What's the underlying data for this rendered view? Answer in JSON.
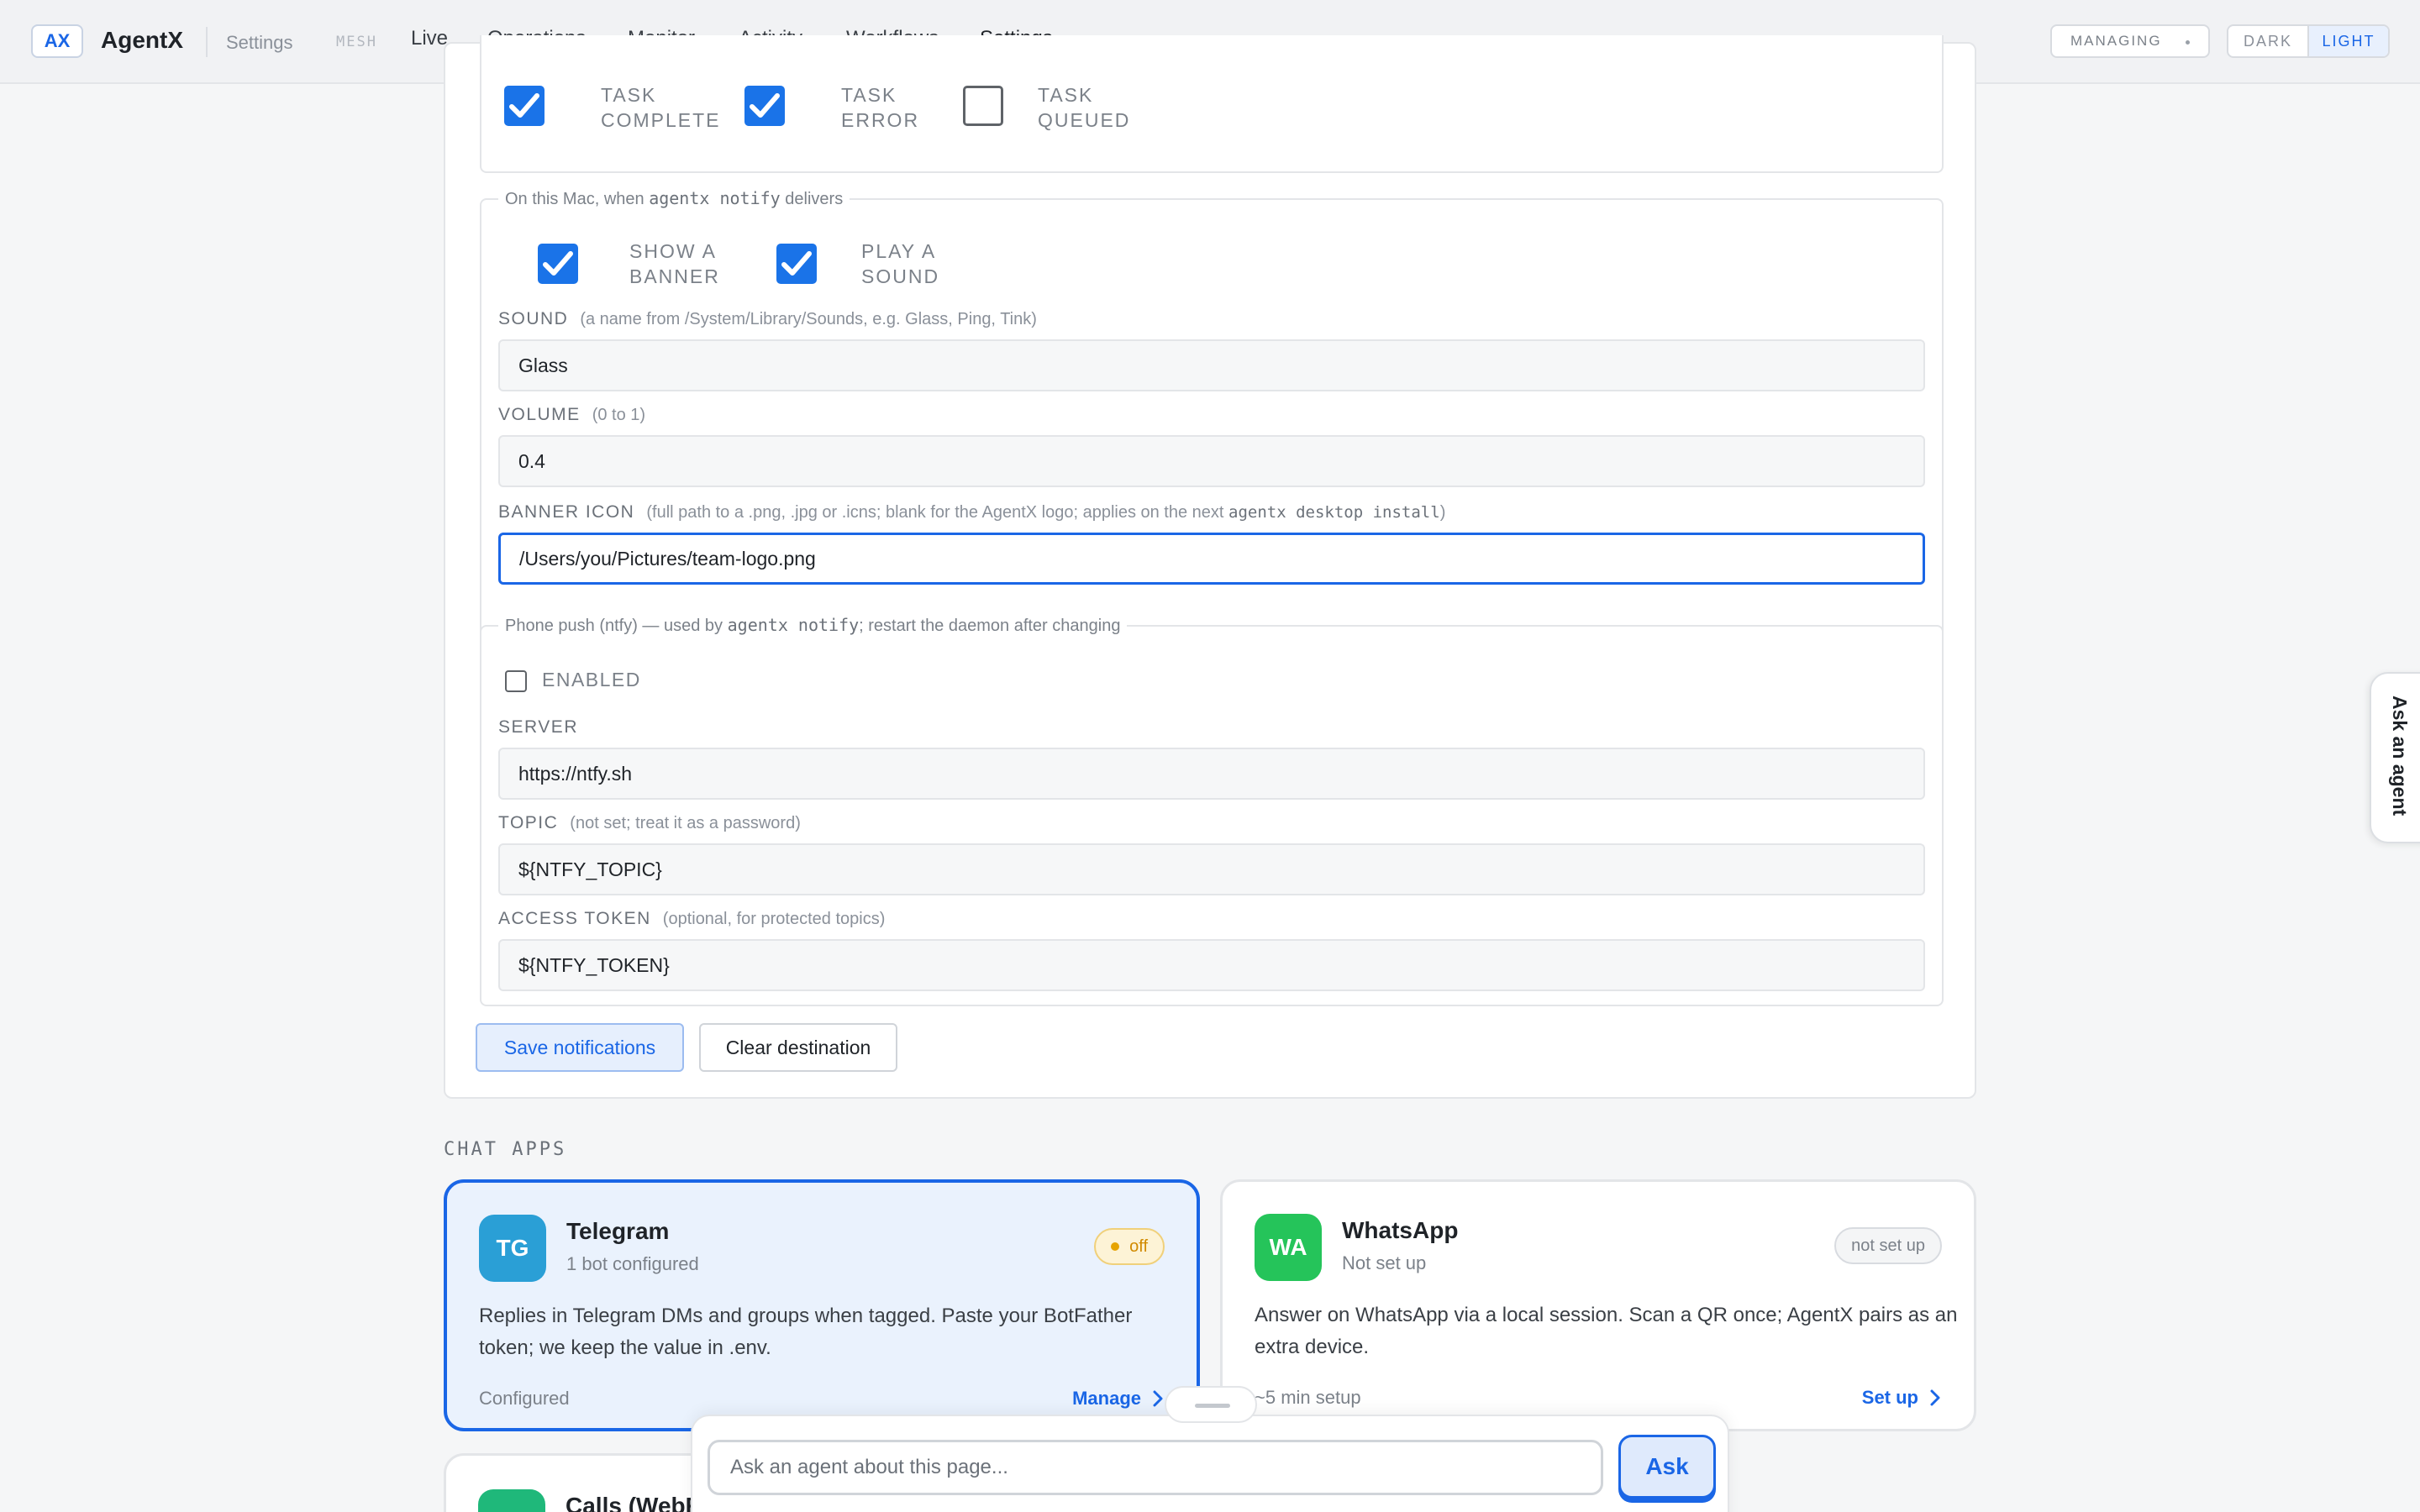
{
  "header": {
    "logo": "AX",
    "app_name": "AgentX",
    "breadcrumb": "Settings",
    "mesh": "MESH",
    "nav": [
      "Live",
      "Operations",
      "Monitor",
      "Activity",
      "Workflows",
      "Settings"
    ],
    "active_nav": "Settings",
    "managing": "MANAGING",
    "theme_dark": "DARK",
    "theme_light": "LIGHT",
    "theme_selected": "LIGHT"
  },
  "events": {
    "items": [
      {
        "label_1": "TASK",
        "label_2": "COMPLETE",
        "checked": true
      },
      {
        "label_1": "TASK",
        "label_2": "ERROR",
        "checked": true
      },
      {
        "label_1": "TASK",
        "label_2": "QUEUED",
        "checked": false
      }
    ]
  },
  "mac": {
    "legend_pre": "On this Mac, when",
    "legend_code": "agentx notify",
    "legend_post": "delivers",
    "banner_1": "SHOW A",
    "banner_2": "BANNER",
    "banner_checked": true,
    "sound_1": "PLAY A",
    "sound_2": "SOUND",
    "sound_checked": true,
    "sound_label": "SOUND",
    "sound_hint": "(a name from /System/Library/Sounds, e.g. Glass, Ping, Tink)",
    "sound_value": "Glass",
    "volume_label": "VOLUME",
    "volume_hint": "(0 to 1)",
    "volume_value": "0.4",
    "icon_label": "BANNER ICON",
    "icon_hint_pre": "(full path to a .png, .jpg or .icns; blank for the AgentX logo; applies on the next",
    "icon_hint_code": "agentx desktop install",
    "icon_hint_post": ")",
    "icon_value": "/Users/you/Pictures/team-logo.png"
  },
  "phone": {
    "legend_pre": "Phone push (ntfy) — used by",
    "legend_code": "agentx notify",
    "legend_post": "; restart the daemon after changing",
    "enabled_label": "ENABLED",
    "enabled_checked": false,
    "server_label": "SERVER",
    "server_value": "https://ntfy.sh",
    "topic_label": "TOPIC",
    "topic_hint": "(not set; treat it as a password)",
    "topic_value": "${NTFY_TOPIC}",
    "token_label": "ACCESS TOKEN",
    "token_hint": "(optional, for protected topics)",
    "token_value": "${NTFY_TOKEN}"
  },
  "actions": {
    "save": "Save notifications",
    "clear": "Clear destination"
  },
  "chat_apps": {
    "title": "CHAT APPS",
    "cards": [
      {
        "initials": "TG",
        "color": "#2a9fd6",
        "name": "Telegram",
        "sub": "1 bot configured",
        "status": "off",
        "desc": "Replies in Telegram DMs and groups when tagged. Paste your BotFather token; we keep the value in .env.",
        "foot": "Configured",
        "link": "Manage",
        "selected": true
      },
      {
        "initials": "WA",
        "color": "#25c45a",
        "name": "WhatsApp",
        "sub": "Not set up",
        "status": "not set up",
        "desc": "Answer on WhatsApp via a local session. Scan a QR once; AgentX pairs as an extra device.",
        "foot": "~5 min setup",
        "link": "Set up",
        "selected": false
      }
    ],
    "third_card_title": "Calls (WebR"
  },
  "ask": {
    "placeholder": "Ask an agent about this page...",
    "button": "Ask",
    "side_tab": "Ask an agent"
  },
  "colors": {
    "accent": "#1a66e6",
    "checkbox": "#1a73e8",
    "telegram": "#2a9fd6",
    "whatsapp": "#25c45a",
    "calls": "#1fb87a",
    "status_off": "#e6a300"
  }
}
